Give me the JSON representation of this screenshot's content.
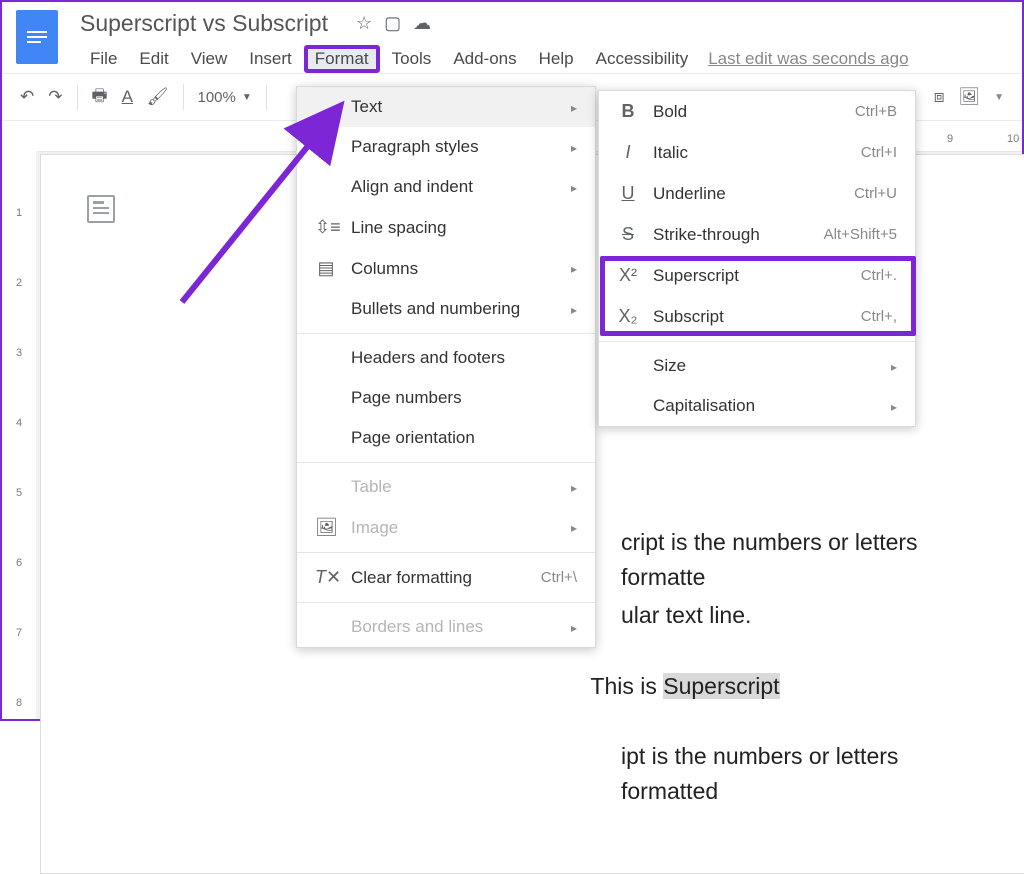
{
  "header": {
    "doc_title": "Superscript vs Subscript",
    "last_edit": "Last edit was seconds ago"
  },
  "menu": {
    "file": "File",
    "edit": "Edit",
    "view": "View",
    "insert": "Insert",
    "format": "Format",
    "tools": "Tools",
    "addons": "Add-ons",
    "help": "Help",
    "accessibility": "Accessibility"
  },
  "toolbar": {
    "zoom": "100%"
  },
  "ruler_h": [
    "9",
    "10"
  ],
  "ruler_v": [
    "1",
    "2",
    "3",
    "4",
    "5",
    "6",
    "7",
    "8"
  ],
  "format_menu": {
    "text": "Text",
    "paragraph": "Paragraph styles",
    "align": "Align and indent",
    "line_spacing": "Line spacing",
    "columns": "Columns",
    "bullets": "Bullets and numbering",
    "hf": "Headers and footers",
    "pn": "Page numbers",
    "orient": "Page orientation",
    "table": "Table",
    "image": "Image",
    "clear": "Clear formatting",
    "clear_s": "Ctrl+\\",
    "borders": "Borders and lines"
  },
  "text_menu": {
    "bold": "Bold",
    "bold_s": "Ctrl+B",
    "italic": "Italic",
    "italic_s": "Ctrl+I",
    "underline": "Underline",
    "underline_s": "Ctrl+U",
    "strike": "Strike-through",
    "strike_s": "Alt+Shift+5",
    "super": "Superscript",
    "super_s": "Ctrl+.",
    "sub": "Subscript",
    "sub_s": "Ctrl+,",
    "size": "Size",
    "cap": "Capitalisation"
  },
  "document": {
    "line1": "cript is the numbers or letters formatte",
    "line2": "ular text line.",
    "line3a": "This is ",
    "line3b": "Superscript",
    "line4": "ipt is the numbers or letters formatted"
  }
}
